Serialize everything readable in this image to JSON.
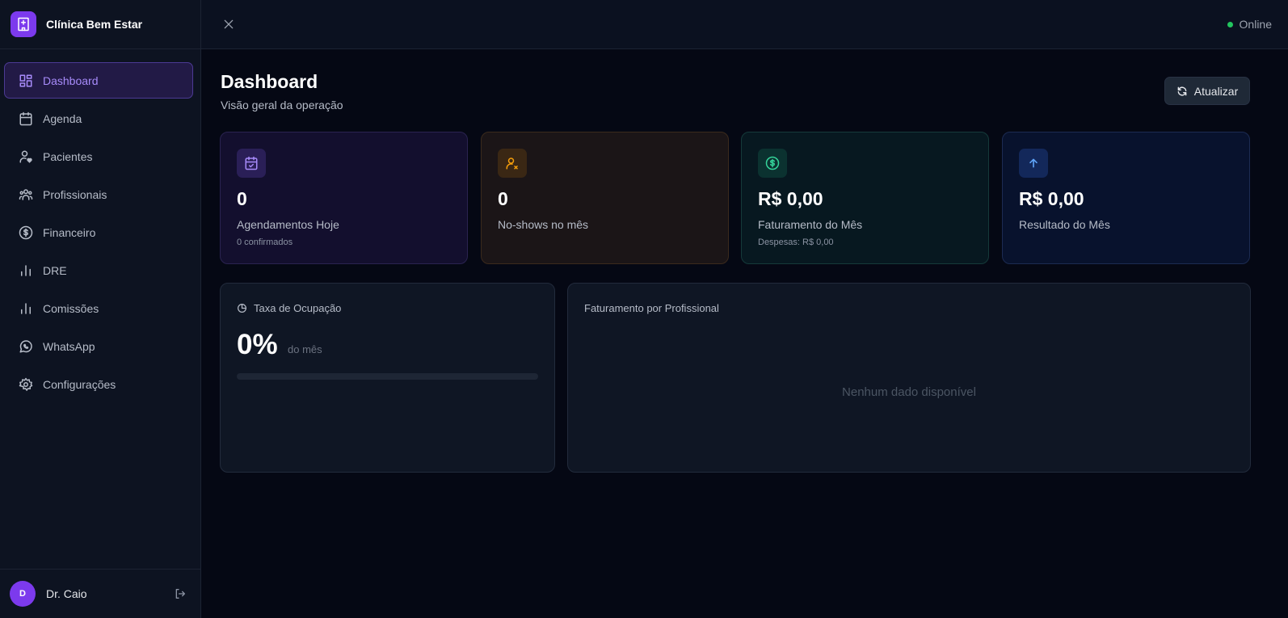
{
  "sidebar": {
    "brand": "Clínica Bem Estar",
    "items": [
      {
        "label": "Dashboard",
        "icon": "dashboard-icon",
        "active": true
      },
      {
        "label": "Agenda",
        "icon": "calendar-icon"
      },
      {
        "label": "Pacientes",
        "icon": "user-heart-icon"
      },
      {
        "label": "Profissionais",
        "icon": "users-icon"
      },
      {
        "label": "Financeiro",
        "icon": "dollar-circle-icon"
      },
      {
        "label": "DRE",
        "icon": "bar-chart-icon"
      },
      {
        "label": "Comissões",
        "icon": "bar-chart-icon"
      },
      {
        "label": "WhatsApp",
        "icon": "whatsapp-icon"
      },
      {
        "label": "Configurações",
        "icon": "gear-icon"
      }
    ],
    "user": {
      "initial": "D",
      "name": "Dr. Caio"
    }
  },
  "topbar": {
    "status": "Online"
  },
  "header": {
    "title": "Dashboard",
    "subtitle": "Visão geral da operação",
    "refresh_label": "Atualizar"
  },
  "stats": [
    {
      "value": "0",
      "label": "Agendamentos Hoje",
      "sub": "0 confirmados",
      "icon": "calendar-check-icon",
      "accent": "#a78bfa"
    },
    {
      "value": "0",
      "label": "No-shows no mês",
      "sub": "",
      "icon": "user-x-icon",
      "accent": "#f59e0b"
    },
    {
      "value": "R$ 0,00",
      "label": "Faturamento do Mês",
      "sub": "Despesas: R$ 0,00",
      "icon": "dollar-circle-icon",
      "accent": "#34d399"
    },
    {
      "value": "R$ 0,00",
      "label": "Resultado do Mês",
      "sub": "",
      "icon": "arrow-up-icon",
      "accent": "#60a5fa"
    }
  ],
  "occupancy": {
    "title": "Taxa de Ocupação",
    "value": "0%",
    "sub": "do mês",
    "progress": 0
  },
  "revenue_by_professional": {
    "title": "Faturamento por Profissional",
    "empty": "Nenhum dado disponível"
  },
  "colors": {
    "accent": "#7c3aed",
    "online": "#22c55e",
    "background": "#050814",
    "sidebar": "#0d1321"
  }
}
